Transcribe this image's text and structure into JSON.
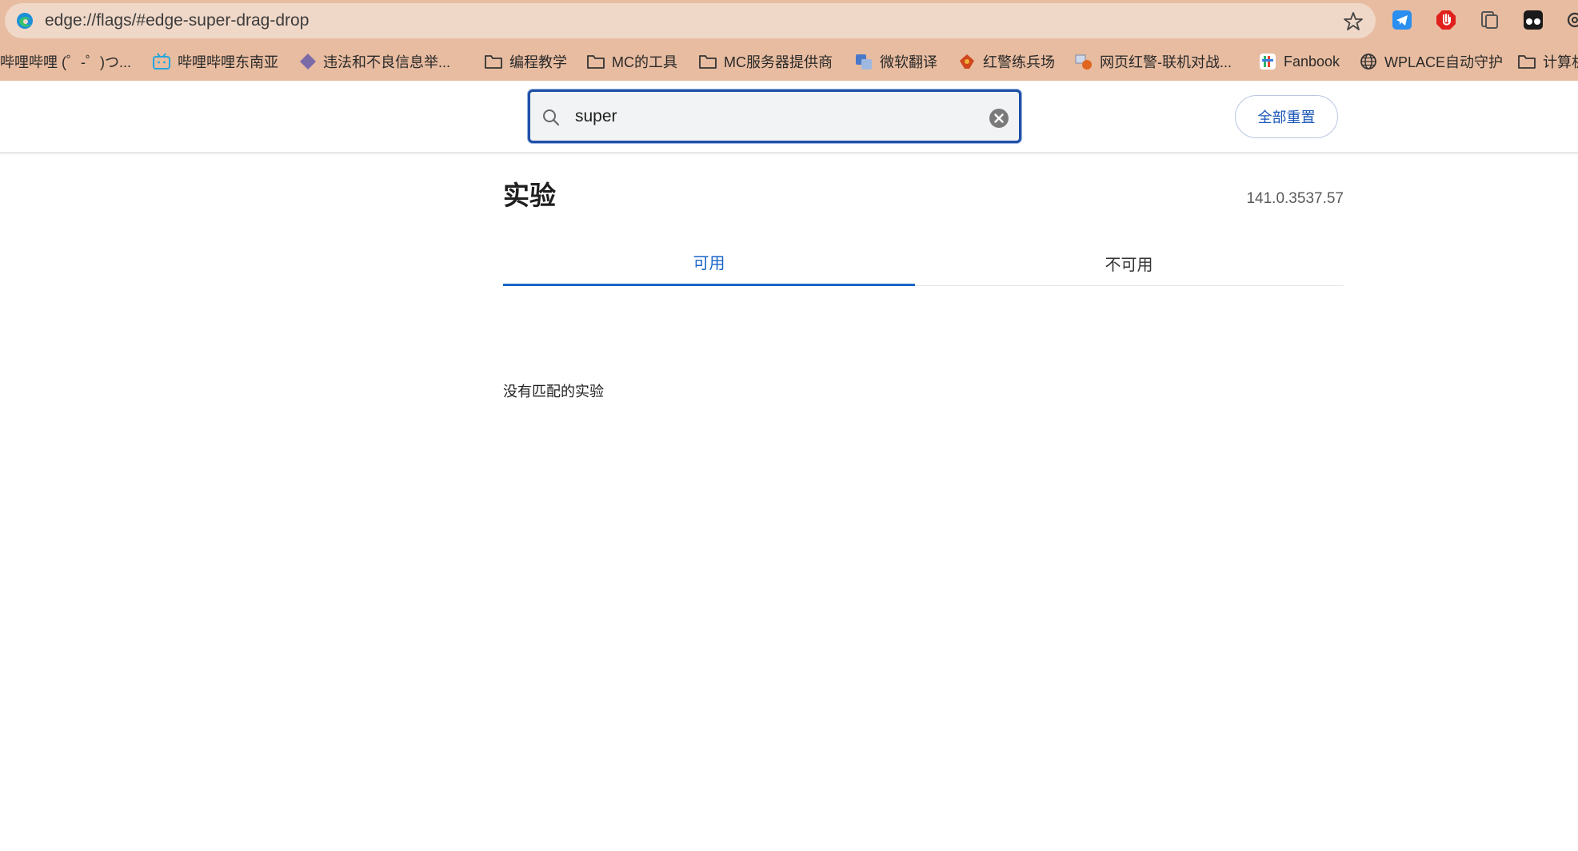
{
  "browser": {
    "url": "edge://flags/#edge-super-drag-drop",
    "bookmarks": [
      {
        "label": "哔哩哔哩 (゜-゜)つ...",
        "icon": "bilibili-icon"
      },
      {
        "label": "哔哩哔哩东南亚",
        "icon": "bilibili-tv-icon"
      },
      {
        "label": "违法和不良信息举...",
        "icon": "diamond-icon"
      },
      {
        "label": "编程教学",
        "icon": "folder-icon"
      },
      {
        "label": "MC的工具",
        "icon": "folder-icon"
      },
      {
        "label": "MC服务器提供商",
        "icon": "folder-icon"
      },
      {
        "label": "微软翻译",
        "icon": "translate-icon"
      },
      {
        "label": "红警练兵场",
        "icon": "game-icon"
      },
      {
        "label": "网页红警-联机对战...",
        "icon": "game-icon"
      },
      {
        "label": "Fanbook",
        "icon": "fanbook-icon"
      },
      {
        "label": "WPLACE自动守护",
        "icon": "globe-icon"
      },
      {
        "label": "计算机",
        "icon": "folder-icon"
      }
    ]
  },
  "header": {
    "search_value": "super",
    "reset_label": "全部重置"
  },
  "main": {
    "title": "实验",
    "version": "141.0.3537.57",
    "tabs": [
      {
        "label": "可用",
        "active": true
      },
      {
        "label": "不可用",
        "active": false
      }
    ],
    "empty_message": "没有匹配的实验"
  },
  "colors": {
    "accent": "#1a66c8",
    "chrome": "#e8bca0",
    "search_border": "#1f4fa8"
  }
}
